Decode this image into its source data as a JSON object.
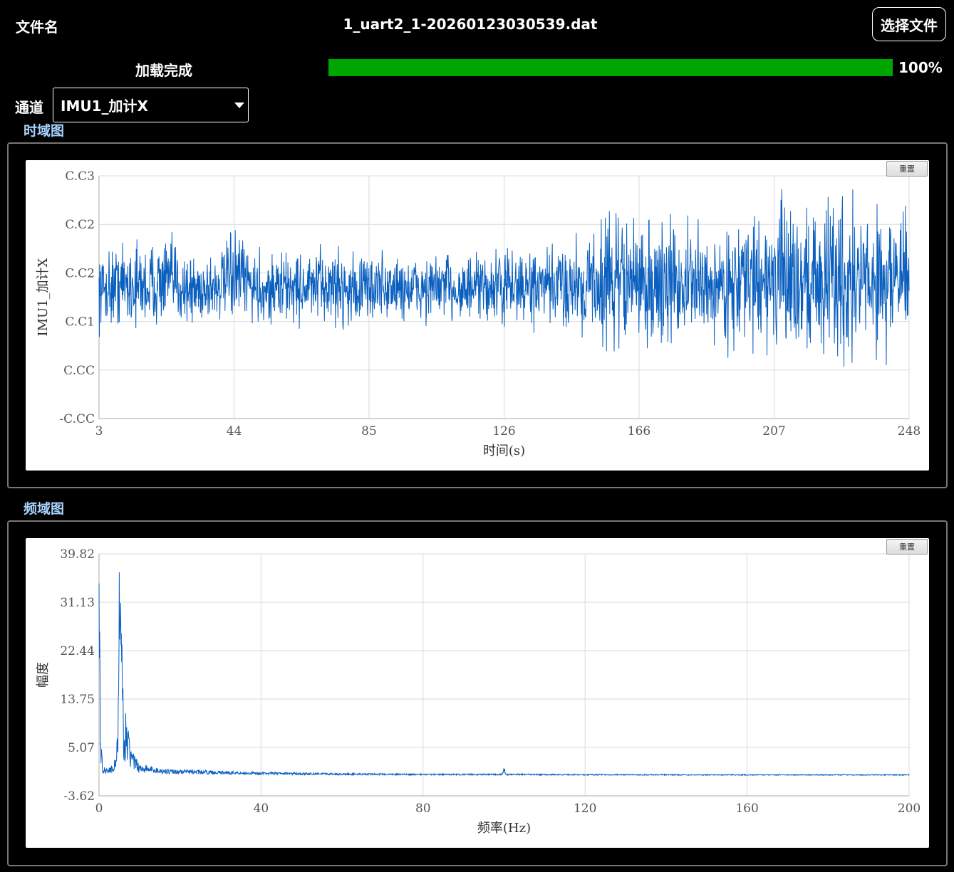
{
  "header": {
    "file_label": "文件名",
    "file_name": "1_uart2_1-20260123030539.dat",
    "choose_button": "选择文件"
  },
  "loading": {
    "status": "加载完成",
    "progress": 100,
    "progress_text": "100%"
  },
  "channel": {
    "label": "通道",
    "selected": "IMU1_加计X"
  },
  "colors": {
    "accent_title": "#a8d4ff",
    "progress": "#00a600",
    "series": "#0a5fbf"
  },
  "chart_data": [
    {
      "type": "line",
      "section_title": "时域图",
      "reset_label": "重置",
      "xlabel": "时间(s)",
      "ylabel": "IMU1_加计X",
      "xlim": [
        3,
        248
      ],
      "ylim": [
        -0.005,
        0.03
      ],
      "x_ticks": [
        "3",
        "44",
        "85",
        "126",
        "166",
        "207",
        "248"
      ],
      "y_ticks": [
        "C.C3",
        "C.C2",
        "C.C2",
        "C.C1",
        "C.CC",
        "-C.CC"
      ],
      "grid": true,
      "series": [
        {
          "x": [
            3,
            10,
            17,
            24,
            31,
            38,
            45,
            52,
            59,
            66,
            73,
            80,
            87,
            94,
            101,
            108,
            115,
            122,
            129,
            136,
            143,
            150,
            157,
            164,
            171,
            178,
            185,
            192,
            199,
            206,
            213,
            220,
            227,
            234,
            241,
            248
          ],
          "y": [
            0.0135,
            0.0145,
            0.014,
            0.015,
            0.0135,
            0.014,
            0.0155,
            0.0135,
            0.014,
            0.0138,
            0.0142,
            0.0135,
            0.014,
            0.0138,
            0.0136,
            0.014,
            0.0135,
            0.0138,
            0.014,
            0.0136,
            0.0142,
            0.0145,
            0.0148,
            0.015,
            0.014,
            0.0145,
            0.0142,
            0.014,
            0.0148,
            0.015,
            0.0152,
            0.015,
            0.0155,
            0.0148,
            0.0152,
            0.015
          ],
          "amplitude": [
            0.003,
            0.0035,
            0.0035,
            0.0035,
            0.003,
            0.003,
            0.0035,
            0.003,
            0.003,
            0.003,
            0.0032,
            0.003,
            0.003,
            0.0028,
            0.0028,
            0.003,
            0.0028,
            0.003,
            0.0032,
            0.003,
            0.0035,
            0.0045,
            0.0055,
            0.0055,
            0.005,
            0.005,
            0.0045,
            0.0045,
            0.005,
            0.0055,
            0.0065,
            0.0065,
            0.007,
            0.006,
            0.0065,
            0.006
          ]
        }
      ]
    },
    {
      "type": "line",
      "section_title": "频域图",
      "reset_label": "重置",
      "xlabel": "频率(Hz)",
      "ylabel": "幅度",
      "xlim": [
        0,
        200
      ],
      "ylim": [
        -3.62,
        39.82
      ],
      "x_ticks": [
        "0",
        "40",
        "80",
        "120",
        "160",
        "200"
      ],
      "y_ticks": [
        "39.82",
        "31.13",
        "22.44",
        "13.75",
        "5.07",
        "-3.62"
      ],
      "grid": true,
      "series": [
        {
          "x": [
            0,
            0.2,
            0.5,
            1,
            2,
            3,
            4,
            4.5,
            5,
            5.5,
            6,
            7,
            8,
            10,
            15,
            20,
            30,
            40,
            60,
            80,
            99.5,
            100,
            100.5,
            120,
            160,
            200
          ],
          "y": [
            34.5,
            22,
            5,
            1.5,
            1.2,
            1.5,
            3,
            6,
            36.5,
            27,
            11,
            9,
            4,
            2,
            1.2,
            1.0,
            0.8,
            0.6,
            0.4,
            0.3,
            0.3,
            1.8,
            0.3,
            0.25,
            0.2,
            0.2
          ]
        }
      ]
    }
  ]
}
